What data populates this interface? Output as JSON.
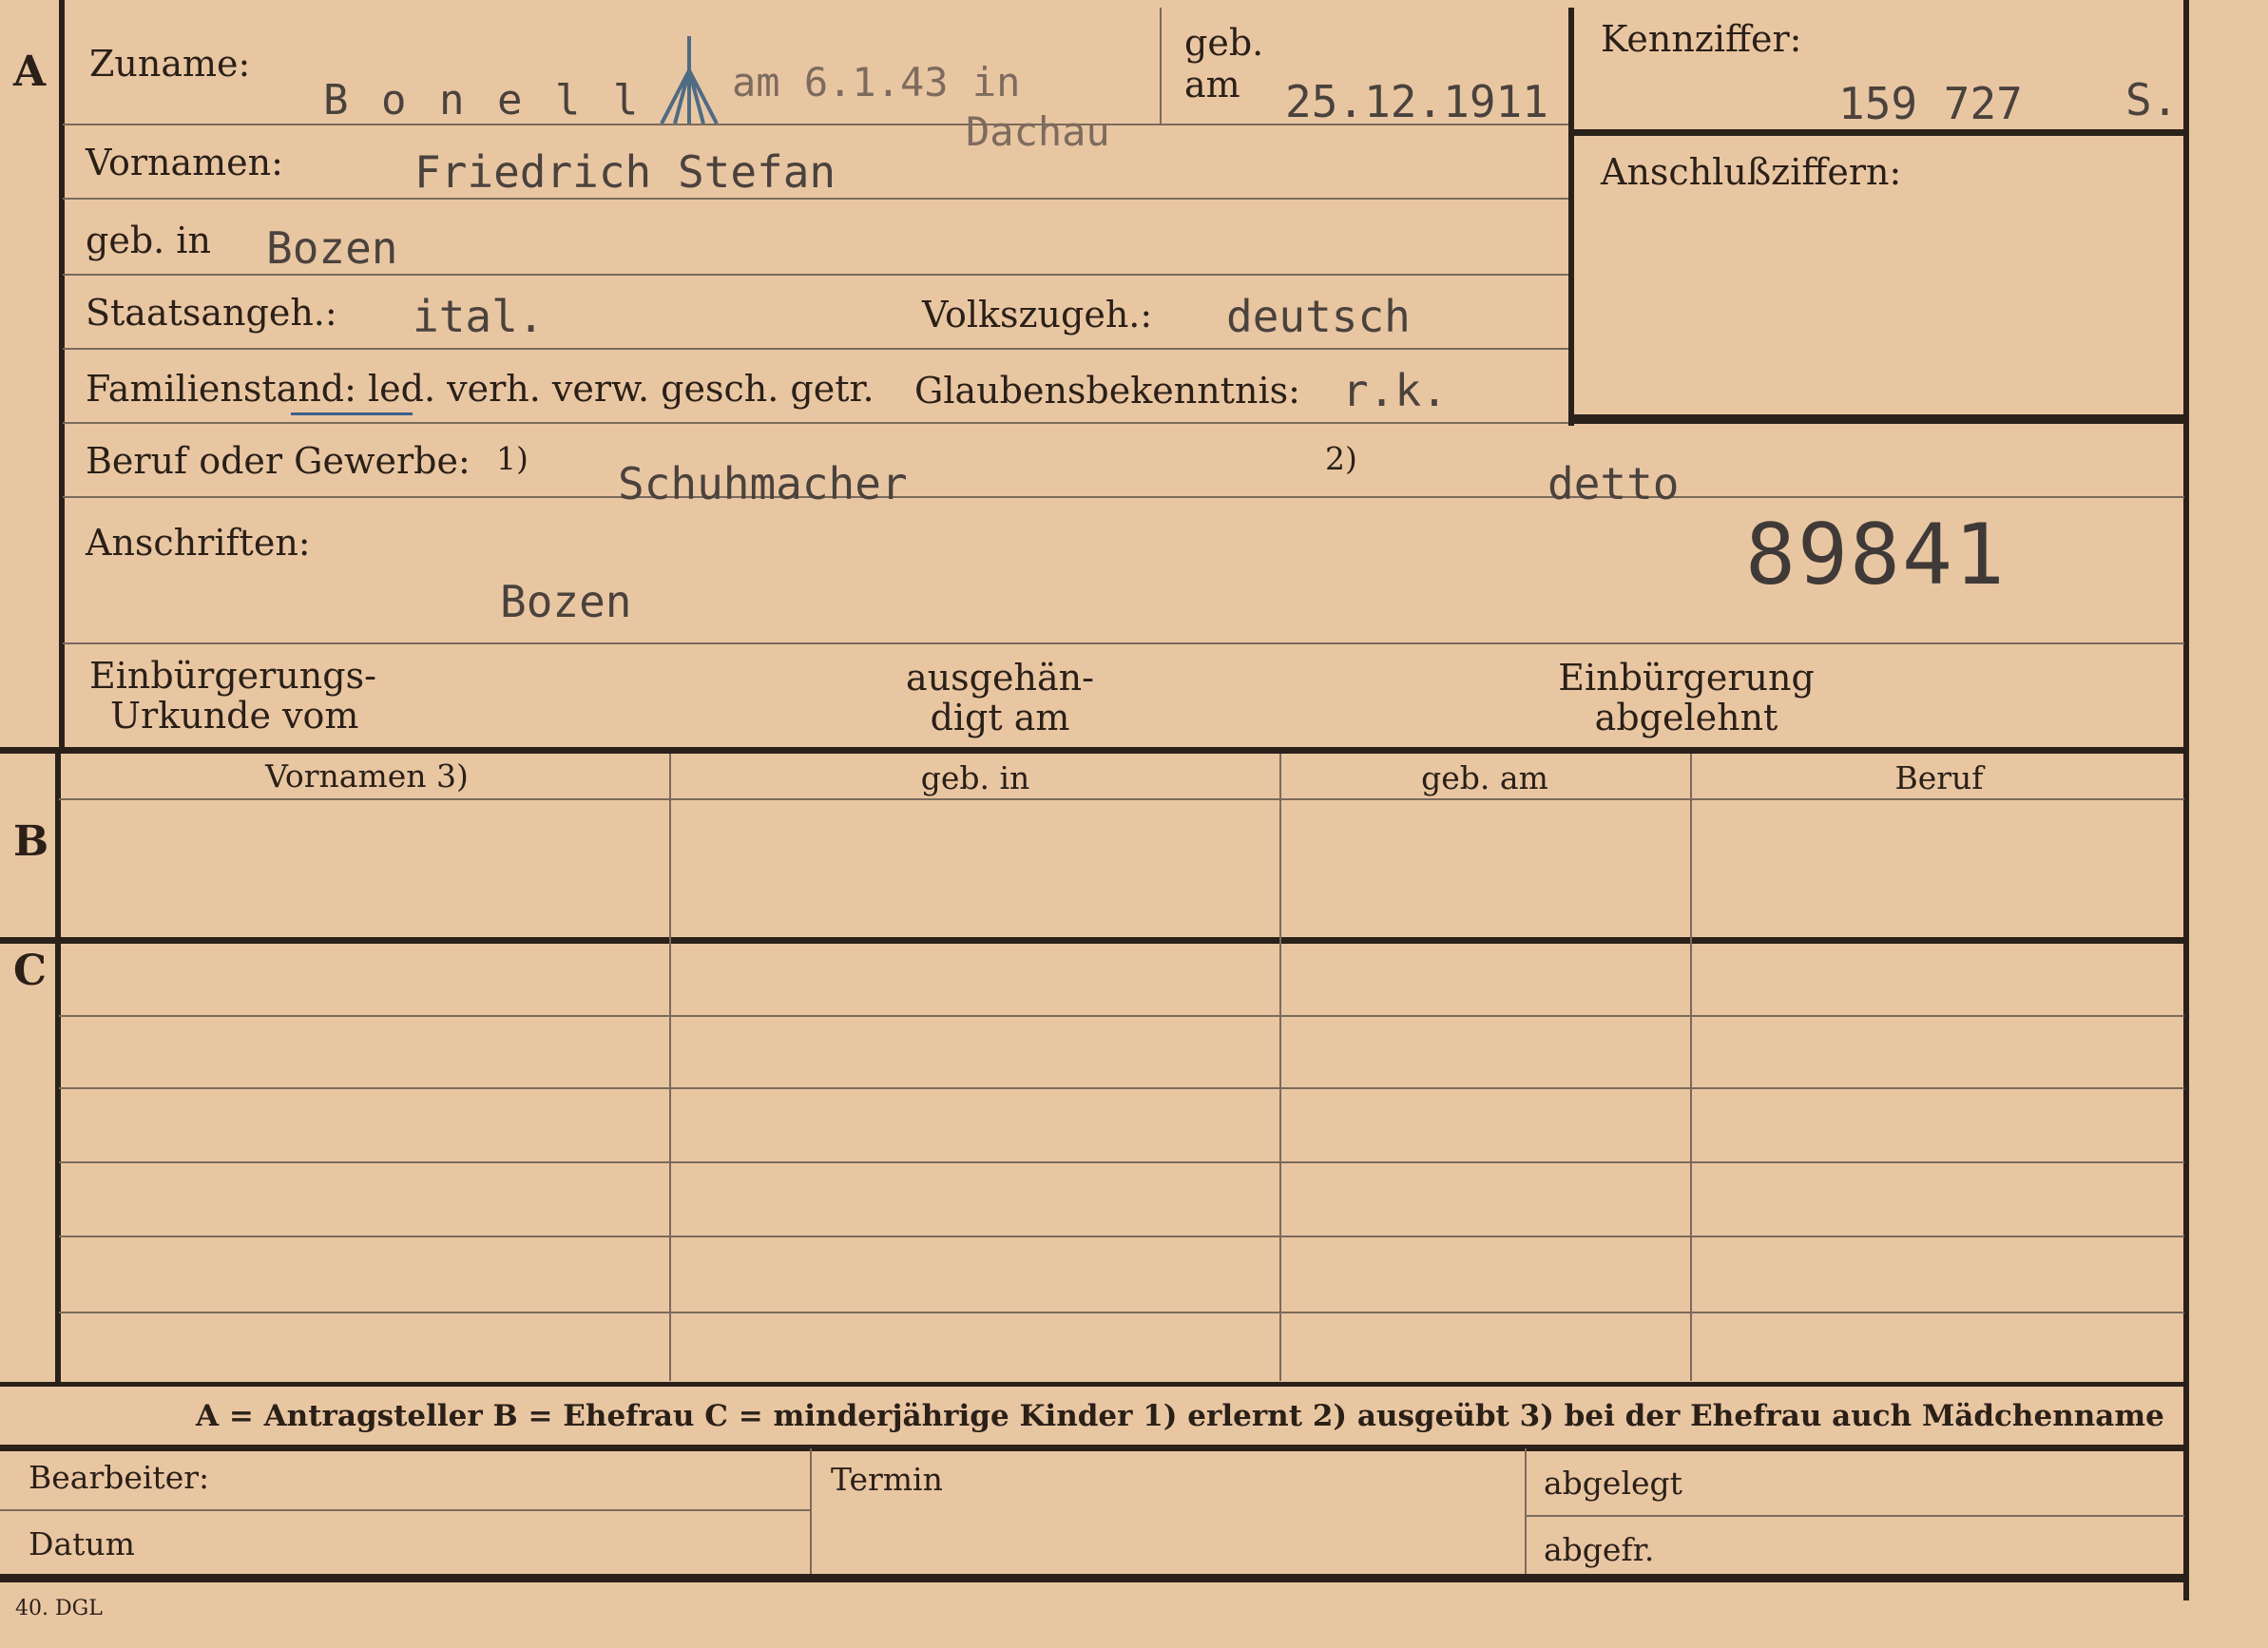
{
  "sections": {
    "a": "A",
    "b": "B",
    "c": "C"
  },
  "top": {
    "zuname_label": "Zuname:",
    "zuname_value": "B o n e l l",
    "death_note_line1": "am 6.1.43 in",
    "death_note_line2": "Dachau",
    "geb_label_1": "geb.",
    "geb_label_2": "am",
    "geb_am_value": "25.12.1911",
    "kennziffer_label": "Kennziffer:",
    "kennziffer_value": "159 727",
    "kennziffer_suffix": "S.",
    "anschluss_label": "Anschlußziffern:",
    "vornamen_label": "Vornamen:",
    "vornamen_value": "Friedrich Stefan",
    "gebin_label": "geb. in",
    "gebin_value": "Bozen",
    "staat_label": "Staatsangeh.:",
    "staat_value": "ital.",
    "volk_label": "Volkszugeh.:",
    "volk_value": "deutsch",
    "familien_label": "Familienstand: led. verh. verw. gesch. getr.",
    "glauben_label": "Glaubensbekenntnis:",
    "glauben_value": "r.k.",
    "beruf_label": "Beruf oder Gewerbe:",
    "beruf_fn1": "1)",
    "beruf_value1": "Schuhmacher",
    "beruf_fn2": "2)",
    "beruf_value2": "detto",
    "anschriften_label": "Anschriften:",
    "anschriften_value": "Bozen",
    "stamp_number": "89841",
    "einb_urkunde_1": "Einbürgerungs-",
    "einb_urkunde_2": "Urkunde vom",
    "ausgehaendigt_1": "ausgehän-",
    "ausgehaendigt_2": "digt am",
    "einb_abgelehnt_1": "Einbürgerung",
    "einb_abgelehnt_2": "abgelehnt"
  },
  "table": {
    "headers": [
      "Vornamen 3)",
      "geb. in",
      "geb. am",
      "Beruf"
    ]
  },
  "legend": "A = Antragsteller    B = Ehefrau    C = minderjährige Kinder    1) erlernt    2) ausgeübt    3) bei der Ehefrau auch Mädchenname",
  "footer": {
    "bearbeiter": "Bearbeiter:",
    "datum": "Datum",
    "termin": "Termin",
    "abgelegt": "abgelegt",
    "abgefr": "abgefr.",
    "print_code": "40. DGL"
  }
}
